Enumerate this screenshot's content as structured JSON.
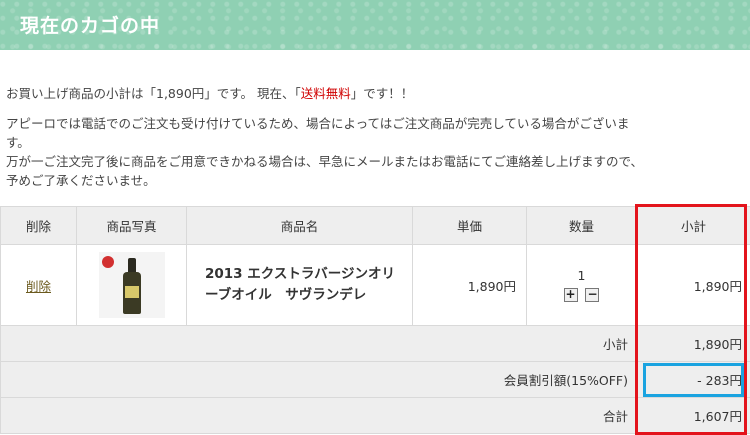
{
  "header": {
    "title": "現在のカゴの中"
  },
  "info": {
    "subtotal_line_prefix": "お買い上げ商品の小計は「1,890円」です。 現在、「",
    "free_shipping": "送料無料",
    "subtotal_line_suffix": "」です！！",
    "notice_line1": "アピーロでは電話でのご注文も受け付けているため、場合によってはご注文商品が完売している場合がございま",
    "notice_line2": "す。",
    "notice_line3": "万が一ご注文完了後に商品をご用意できかねる場合は、早急にメールまたはお電話にてご連絡差し上げますので、",
    "notice_line4": "予めご了承くださいませ。"
  },
  "table": {
    "headers": {
      "delete": "削除",
      "photo": "商品写真",
      "name": "商品名",
      "unit_price": "単価",
      "quantity": "数量",
      "subtotal": "小計"
    },
    "items": [
      {
        "delete_label": "削除",
        "name": "2013 エクストラバージンオリーブオイル　サヴランデレ",
        "unit_price": "1,890円",
        "quantity": "1",
        "plus": "+",
        "minus": "−",
        "subtotal": "1,890円"
      }
    ],
    "summary": {
      "subtotal_label": "小計",
      "subtotal_value": "1,890円",
      "discount_label": "会員割引額(15%OFF)",
      "discount_value": "- 283円",
      "total_label": "合計",
      "total_value": "1,607円"
    }
  },
  "colors": {
    "banner": "#8fd0b3",
    "free_shipping_text": "#d00000",
    "highlight_red": "#e3141c",
    "highlight_blue": "#1aa3e0"
  }
}
